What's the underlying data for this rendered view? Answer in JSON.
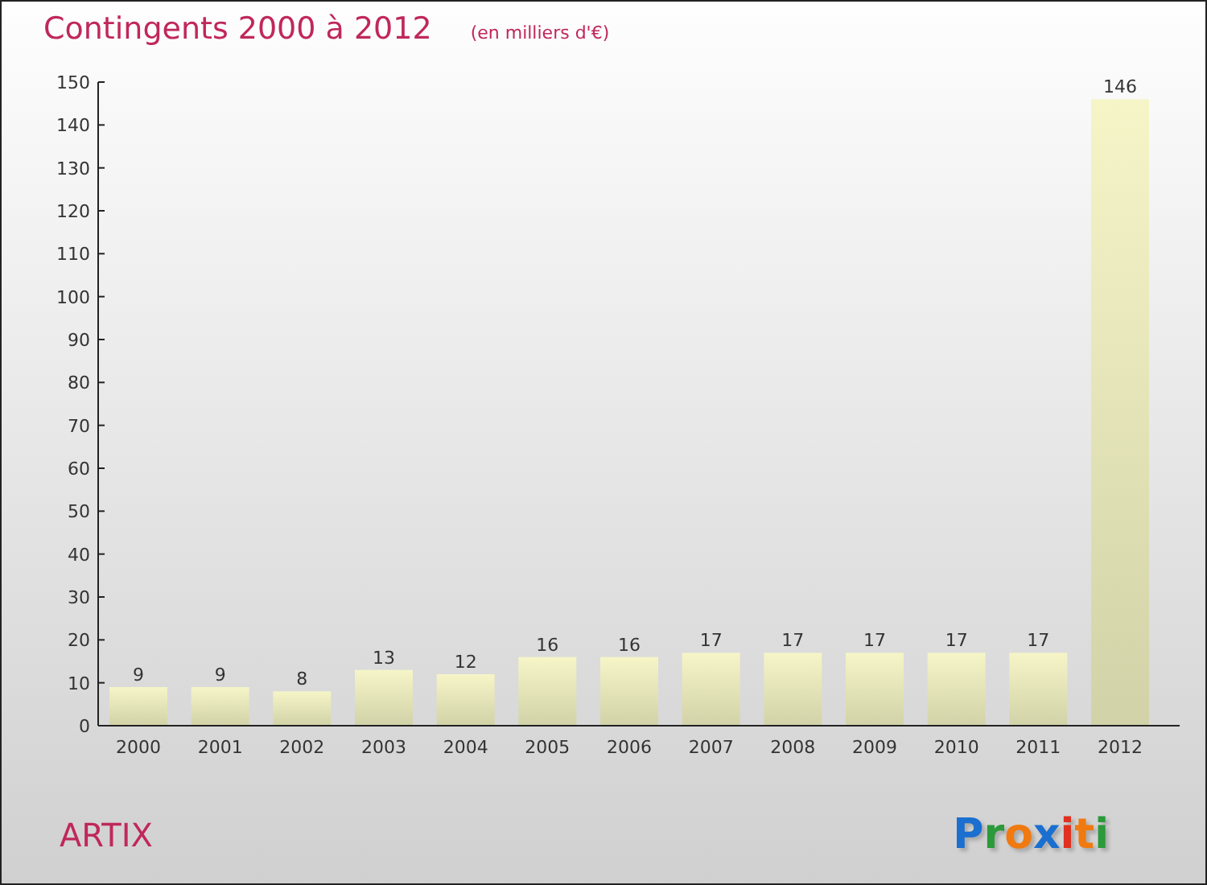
{
  "title": "Contingents 2000 à 2012",
  "subtitle": "(en milliers d'€)",
  "chart_data": {
    "type": "bar",
    "categories": [
      "2000",
      "2001",
      "2002",
      "2003",
      "2004",
      "2005",
      "2006",
      "2007",
      "2008",
      "2009",
      "2010",
      "2011",
      "2012"
    ],
    "series": [
      {
        "color": "#f5f5c8",
        "values": [
          9,
          9,
          8,
          13,
          12,
          16,
          16,
          17,
          17,
          17,
          17,
          17,
          146
        ]
      }
    ],
    "ylim": [
      0,
      150
    ],
    "yticks": [
      0,
      10,
      20,
      30,
      40,
      50,
      60,
      70,
      80,
      90,
      100,
      110,
      120,
      130,
      140,
      150
    ],
    "data_labels": true
  },
  "place": "ARTIX",
  "logo": "Proxiti"
}
